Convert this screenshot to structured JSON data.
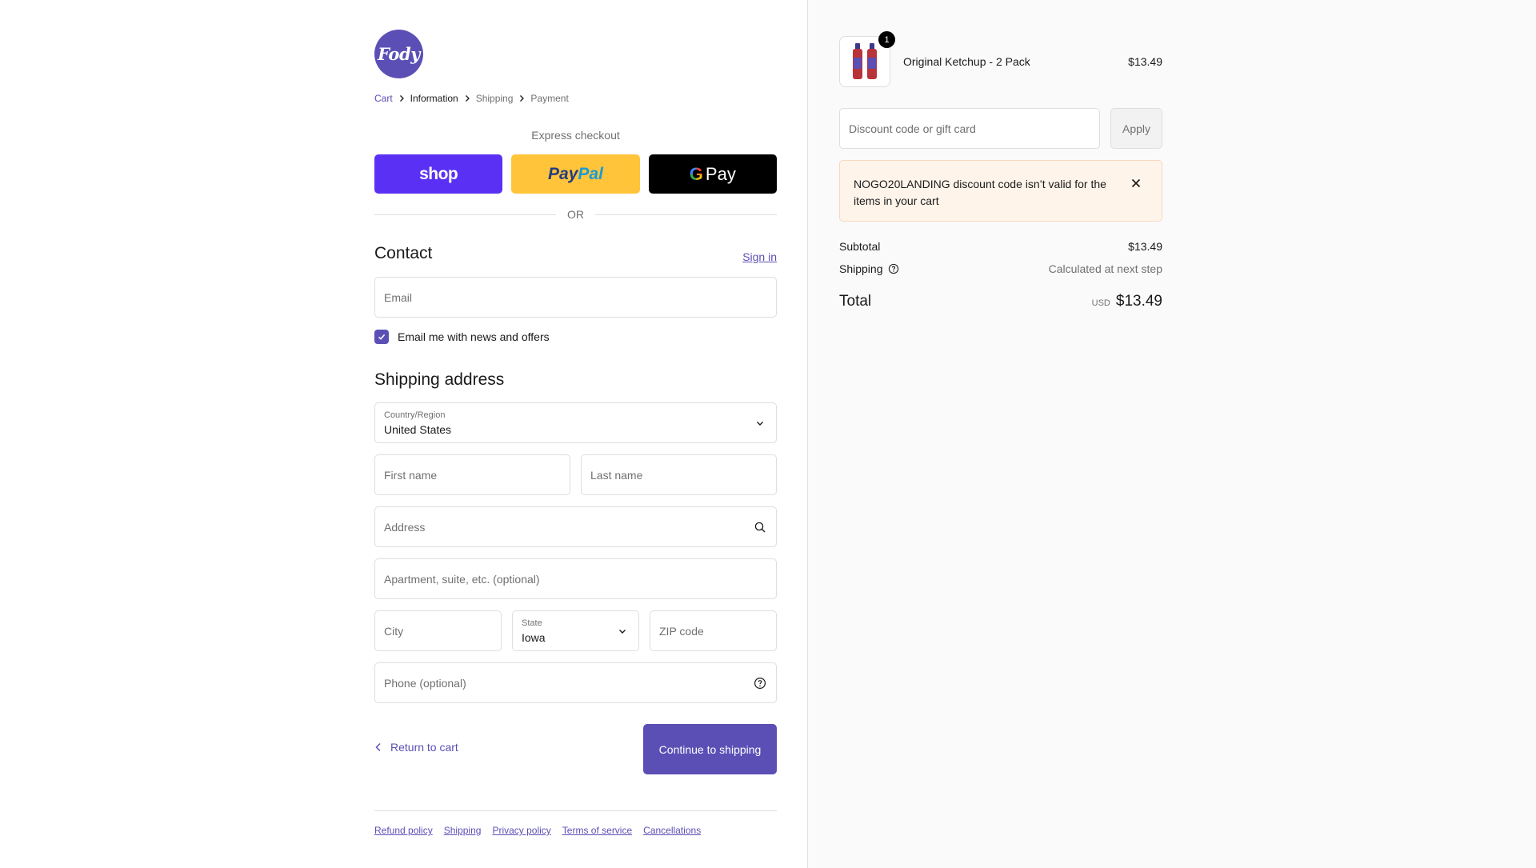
{
  "brand": {
    "logo_text": "Fody",
    "accent": "#5b4fb5"
  },
  "breadcrumb": [
    "Cart",
    "Information",
    "Shipping",
    "Payment"
  ],
  "express": {
    "title": "Express checkout",
    "shop_label": "shop",
    "paypal_label_1": "Pay",
    "paypal_label_2": "Pal",
    "gpay_g": "G",
    "gpay_label": "Pay",
    "or_text": "OR"
  },
  "contact": {
    "heading": "Contact",
    "signin_label": "Sign in",
    "email_placeholder": "Email",
    "newsletter_label": "Email me with news and offers",
    "newsletter_checked": true
  },
  "shipping": {
    "heading": "Shipping address",
    "country_label": "Country/Region",
    "country_value": "United States",
    "first_name_placeholder": "First name",
    "last_name_placeholder": "Last name",
    "address_placeholder": "Address",
    "apartment_placeholder": "Apartment, suite, etc. (optional)",
    "city_placeholder": "City",
    "state_label": "State",
    "state_value": "Iowa",
    "zip_placeholder": "ZIP code",
    "phone_placeholder": "Phone (optional)"
  },
  "actions": {
    "return_label": "Return to cart",
    "continue_label": "Continue to shipping"
  },
  "footer_links": [
    "Refund policy",
    "Shipping",
    "Privacy policy",
    "Terms of service",
    "Cancellations"
  ],
  "summary": {
    "product": {
      "name": "Original Ketchup - 2 Pack",
      "price": "$13.49",
      "quantity": "1"
    },
    "discount_placeholder": "Discount code or gift card",
    "apply_label": "Apply",
    "alert_message": "NOGO20LANDING discount code isn’t valid for the items in your cart",
    "subtotal_label": "Subtotal",
    "subtotal_value": "$13.49",
    "shipping_label": "Shipping",
    "shipping_value": "Calculated at next step",
    "total_label": "Total",
    "total_currency": "USD",
    "total_value": "$13.49"
  }
}
